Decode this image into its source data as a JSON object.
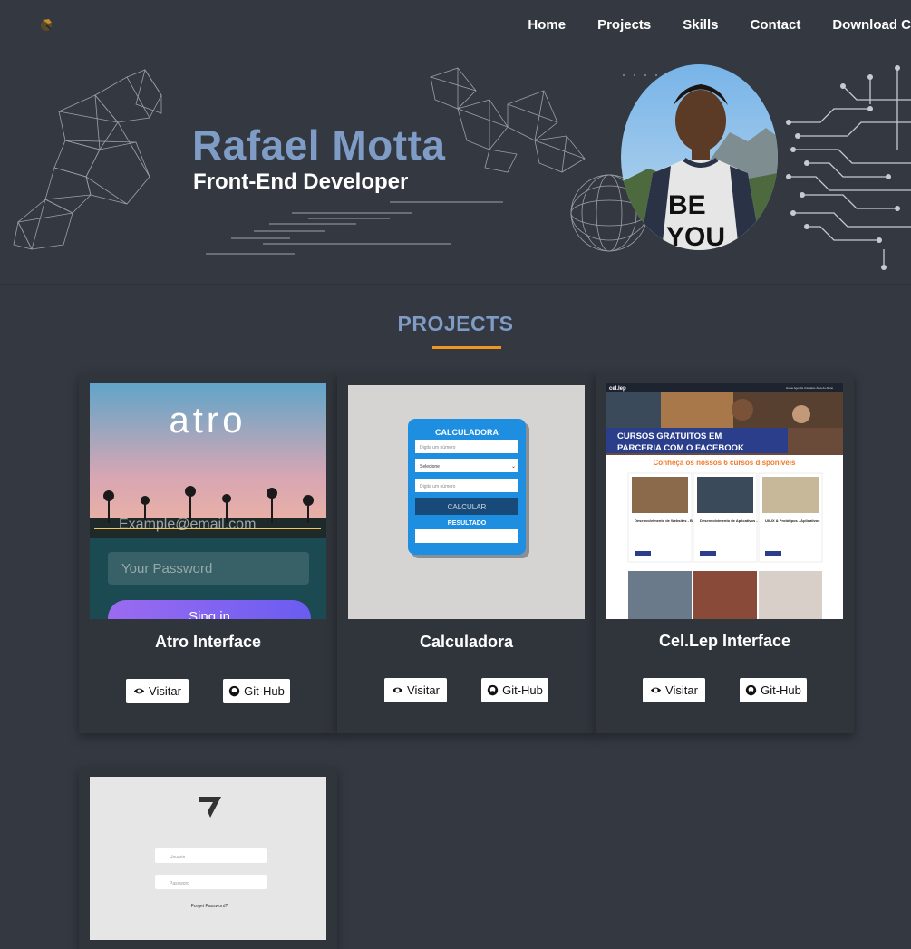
{
  "nav": {
    "items": [
      "Home",
      "Projects",
      "Skills",
      "Contact",
      "Download CV"
    ]
  },
  "hero": {
    "name": "Rafael Motta",
    "role": "Front-End Developer",
    "portrait_shirt_text_1": "BE",
    "portrait_shirt_text_2": "YOU"
  },
  "projects": {
    "title": "PROJECTS",
    "visit_label": "Visitar",
    "git_label": "Git-Hub",
    "cards": [
      {
        "title": "Atro Interface",
        "brand": "atro",
        "email_placeholder": "Example@email.com",
        "password_placeholder": "Your Password",
        "signin_label": "Sing in"
      },
      {
        "title": "Calculadora",
        "app_title": "CALCULADORA",
        "input1_placeholder": "Digita um número",
        "select_value": "Selecione",
        "input2_placeholder": "Digita um número",
        "calc_button": "CALCULAR",
        "result_label": "RESULTADO"
      },
      {
        "title": "Cel.Lep Interface",
        "brand": "cel.lep",
        "nav_text": "Home   Agenda   Unidades   Área do Aluno",
        "banner": "CURSOS GRATUITOS EM PARCERIA COM O FACEBOOK",
        "subtitle": "Conheça os nossos 6 cursos disponíveis",
        "course1": "Desenvolvimento de Websites - Back-end",
        "course2": "Desenvolvimento de Aplicativos - Android Kotlin",
        "course3": "UI/UX & Protótipos - Aplicativos",
        "course_btn": "Saiba mais"
      },
      {
        "title": "",
        "username_placeholder": "Usuário",
        "password_placeholder": "Password",
        "forgot_label": "Forget Password?"
      }
    ]
  },
  "colors": {
    "background": "#343840",
    "card": "#30343b",
    "accent_blue": "#7e9cc6",
    "accent_orange": "#f0961e"
  }
}
